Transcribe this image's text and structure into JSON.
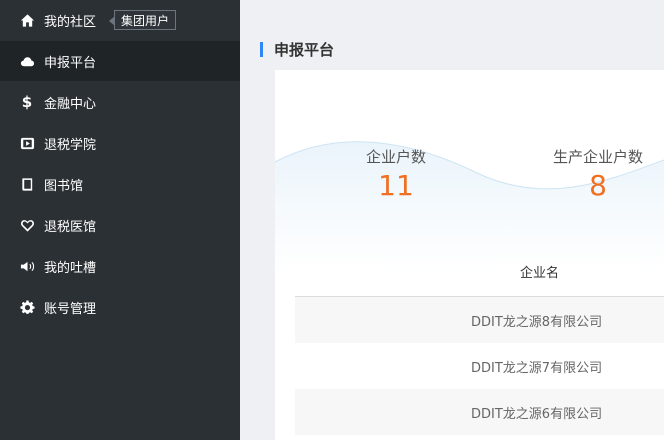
{
  "sidebar": {
    "items": [
      {
        "label": "我的社区",
        "icon": "home-icon"
      },
      {
        "label": "申报平台",
        "icon": "cloud-icon"
      },
      {
        "label": "金融中心",
        "icon": "dollar-icon"
      },
      {
        "label": "退税学院",
        "icon": "play-box-icon"
      },
      {
        "label": "图书馆",
        "icon": "book-icon"
      },
      {
        "label": "退税医馆",
        "icon": "heart-icon"
      },
      {
        "label": "我的吐槽",
        "icon": "megaphone-icon"
      },
      {
        "label": "账号管理",
        "icon": "gear-icon"
      }
    ],
    "active_index": 1,
    "tooltip": "集团用户"
  },
  "main": {
    "section_title": "申报平台",
    "stats": [
      {
        "label": "企业户数",
        "value": "11"
      },
      {
        "label": "生产企业户数",
        "value": "8"
      }
    ],
    "table": {
      "header": "企业名",
      "rows": [
        "DDIT龙之源8有限公司",
        "DDIT龙之源7有限公司",
        "DDIT龙之源6有限公司"
      ]
    }
  },
  "colors": {
    "sidebar_bg": "#2b3035",
    "active_bg": "#1f2427",
    "accent": "#2f86f6",
    "stat_value": "#f07022"
  }
}
